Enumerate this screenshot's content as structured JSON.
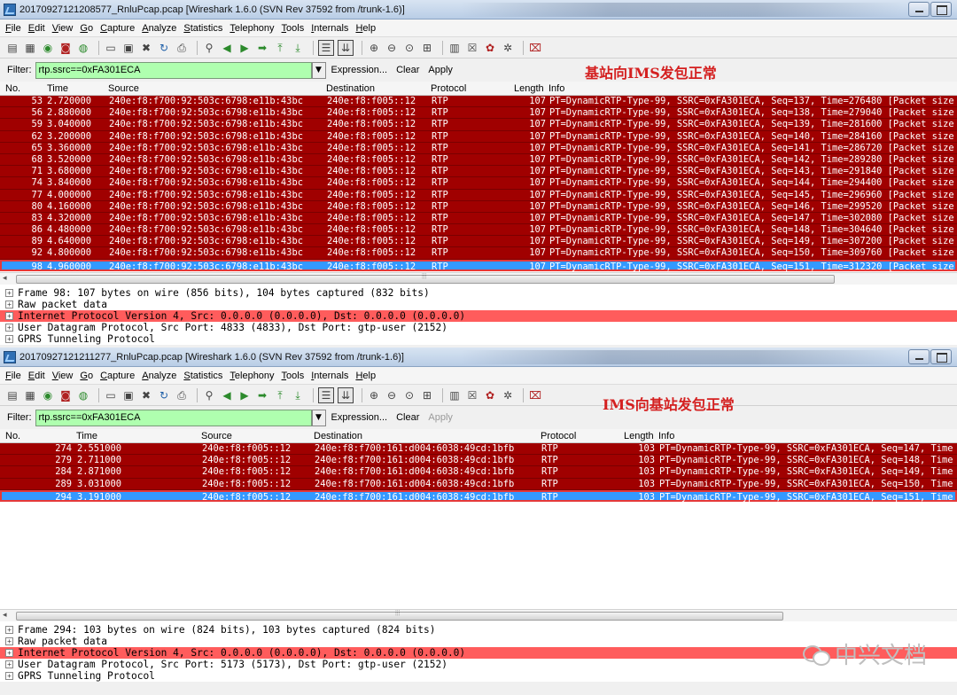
{
  "windows": [
    {
      "title": "20170927121208577_RnluPcap.pcap  [Wireshark 1.6.0  (SVN Rev 37592 from /trunk-1.6)]",
      "menu": [
        "File",
        "Edit",
        "View",
        "Go",
        "Capture",
        "Analyze",
        "Statistics",
        "Telephony",
        "Tools",
        "Internals",
        "Help"
      ],
      "filter": {
        "label": "Filter:",
        "value": "rtp.ssrc==0xFA301ECA",
        "expression": "Expression...",
        "clear": "Clear",
        "apply": "Apply"
      },
      "annotation": "基站向IMS发包正常",
      "columns": [
        "No.",
        "Time",
        "Source",
        "Destination",
        "Protocol",
        "Length",
        "Info"
      ],
      "rows": [
        {
          "no": "53",
          "time": "2.720000",
          "src": "240e:f8:f700:92:503c:6798:e11b:43bc",
          "dst": "240e:f8:f005::12",
          "proto": "RTP",
          "len": "107",
          "info": "PT=DynamicRTP-Type-99, SSRC=0xFA301ECA, Seq=137, Time=276480 [Packet size"
        },
        {
          "no": "56",
          "time": "2.880000",
          "src": "240e:f8:f700:92:503c:6798:e11b:43bc",
          "dst": "240e:f8:f005::12",
          "proto": "RTP",
          "len": "107",
          "info": "PT=DynamicRTP-Type-99, SSRC=0xFA301ECA, Seq=138, Time=279040 [Packet size"
        },
        {
          "no": "59",
          "time": "3.040000",
          "src": "240e:f8:f700:92:503c:6798:e11b:43bc",
          "dst": "240e:f8:f005::12",
          "proto": "RTP",
          "len": "107",
          "info": "PT=DynamicRTP-Type-99, SSRC=0xFA301ECA, Seq=139, Time=281600 [Packet size"
        },
        {
          "no": "62",
          "time": "3.200000",
          "src": "240e:f8:f700:92:503c:6798:e11b:43bc",
          "dst": "240e:f8:f005::12",
          "proto": "RTP",
          "len": "107",
          "info": "PT=DynamicRTP-Type-99, SSRC=0xFA301ECA, Seq=140, Time=284160 [Packet size"
        },
        {
          "no": "65",
          "time": "3.360000",
          "src": "240e:f8:f700:92:503c:6798:e11b:43bc",
          "dst": "240e:f8:f005::12",
          "proto": "RTP",
          "len": "107",
          "info": "PT=DynamicRTP-Type-99, SSRC=0xFA301ECA, Seq=141, Time=286720 [Packet size"
        },
        {
          "no": "68",
          "time": "3.520000",
          "src": "240e:f8:f700:92:503c:6798:e11b:43bc",
          "dst": "240e:f8:f005::12",
          "proto": "RTP",
          "len": "107",
          "info": "PT=DynamicRTP-Type-99, SSRC=0xFA301ECA, Seq=142, Time=289280 [Packet size"
        },
        {
          "no": "71",
          "time": "3.680000",
          "src": "240e:f8:f700:92:503c:6798:e11b:43bc",
          "dst": "240e:f8:f005::12",
          "proto": "RTP",
          "len": "107",
          "info": "PT=DynamicRTP-Type-99, SSRC=0xFA301ECA, Seq=143, Time=291840 [Packet size"
        },
        {
          "no": "74",
          "time": "3.840000",
          "src": "240e:f8:f700:92:503c:6798:e11b:43bc",
          "dst": "240e:f8:f005::12",
          "proto": "RTP",
          "len": "107",
          "info": "PT=DynamicRTP-Type-99, SSRC=0xFA301ECA, Seq=144, Time=294400 [Packet size"
        },
        {
          "no": "77",
          "time": "4.000000",
          "src": "240e:f8:f700:92:503c:6798:e11b:43bc",
          "dst": "240e:f8:f005::12",
          "proto": "RTP",
          "len": "107",
          "info": "PT=DynamicRTP-Type-99, SSRC=0xFA301ECA, Seq=145, Time=296960 [Packet size"
        },
        {
          "no": "80",
          "time": "4.160000",
          "src": "240e:f8:f700:92:503c:6798:e11b:43bc",
          "dst": "240e:f8:f005::12",
          "proto": "RTP",
          "len": "107",
          "info": "PT=DynamicRTP-Type-99, SSRC=0xFA301ECA, Seq=146, Time=299520 [Packet size"
        },
        {
          "no": "83",
          "time": "4.320000",
          "src": "240e:f8:f700:92:503c:6798:e11b:43bc",
          "dst": "240e:f8:f005::12",
          "proto": "RTP",
          "len": "107",
          "info": "PT=DynamicRTP-Type-99, SSRC=0xFA301ECA, Seq=147, Time=302080 [Packet size"
        },
        {
          "no": "86",
          "time": "4.480000",
          "src": "240e:f8:f700:92:503c:6798:e11b:43bc",
          "dst": "240e:f8:f005::12",
          "proto": "RTP",
          "len": "107",
          "info": "PT=DynamicRTP-Type-99, SSRC=0xFA301ECA, Seq=148, Time=304640 [Packet size"
        },
        {
          "no": "89",
          "time": "4.640000",
          "src": "240e:f8:f700:92:503c:6798:e11b:43bc",
          "dst": "240e:f8:f005::12",
          "proto": "RTP",
          "len": "107",
          "info": "PT=DynamicRTP-Type-99, SSRC=0xFA301ECA, Seq=149, Time=307200 [Packet size"
        },
        {
          "no": "92",
          "time": "4.800000",
          "src": "240e:f8:f700:92:503c:6798:e11b:43bc",
          "dst": "240e:f8:f005::12",
          "proto": "RTP",
          "len": "107",
          "info": "PT=DynamicRTP-Type-99, SSRC=0xFA301ECA, Seq=150, Time=309760 [Packet size"
        },
        {
          "no": "98",
          "time": "4.960000",
          "src": "240e:f8:f700:92:503c:6798:e11b:43bc",
          "dst": "240e:f8:f005::12",
          "proto": "RTP",
          "len": "107",
          "info": "PT=DynamicRTP-Type-99, SSRC=0xFA301ECA, Seq=151, Time=312320 [Packet size",
          "selected": true
        }
      ],
      "details": [
        {
          "text": "Frame 98: 107 bytes on wire (856 bits), 104 bytes captured (832 bits)"
        },
        {
          "text": "Raw packet data"
        },
        {
          "text": "Internet Protocol Version 4, Src: 0.0.0.0 (0.0.0.0), Dst: 0.0.0.0 (0.0.0.0)",
          "error": true
        },
        {
          "text": "User Datagram Protocol, Src Port: 4833 (4833), Dst Port: gtp-user (2152)"
        },
        {
          "text": "GPRS Tunneling Protocol"
        }
      ]
    },
    {
      "title": "20170927121211277_RnluPcap.pcap  [Wireshark 1.6.0  (SVN Rev 37592 from /trunk-1.6)]",
      "menu": [
        "File",
        "Edit",
        "View",
        "Go",
        "Capture",
        "Analyze",
        "Statistics",
        "Telephony",
        "Tools",
        "Internals",
        "Help"
      ],
      "filter": {
        "label": "Filter:",
        "value": "rtp.ssrc==0xFA301ECA",
        "expression": "Expression...",
        "clear": "Clear",
        "apply": "Apply"
      },
      "annotation": "IMS向基站发包正常",
      "columns": [
        "No.",
        "Time",
        "Source",
        "Destination",
        "Protocol",
        "Length",
        "Info"
      ],
      "rows": [
        {
          "no": "274",
          "time": "2.551000",
          "src": "240e:f8:f005::12",
          "dst": "240e:f8:f700:161:d004:6038:49cd:1bfb",
          "proto": "RTP",
          "len": "103",
          "info": "PT=DynamicRTP-Type-99, SSRC=0xFA301ECA, Seq=147, Time"
        },
        {
          "no": "279",
          "time": "2.711000",
          "src": "240e:f8:f005::12",
          "dst": "240e:f8:f700:161:d004:6038:49cd:1bfb",
          "proto": "RTP",
          "len": "103",
          "info": "PT=DynamicRTP-Type-99, SSRC=0xFA301ECA, Seq=148, Time"
        },
        {
          "no": "284",
          "time": "2.871000",
          "src": "240e:f8:f005::12",
          "dst": "240e:f8:f700:161:d004:6038:49cd:1bfb",
          "proto": "RTP",
          "len": "103",
          "info": "PT=DynamicRTP-Type-99, SSRC=0xFA301ECA, Seq=149, Time"
        },
        {
          "no": "289",
          "time": "3.031000",
          "src": "240e:f8:f005::12",
          "dst": "240e:f8:f700:161:d004:6038:49cd:1bfb",
          "proto": "RTP",
          "len": "103",
          "info": "PT=DynamicRTP-Type-99, SSRC=0xFA301ECA, Seq=150, Time"
        },
        {
          "no": "294",
          "time": "3.191000",
          "src": "240e:f8:f005::12",
          "dst": "240e:f8:f700:161:d004:6038:49cd:1bfb",
          "proto": "RTP",
          "len": "103",
          "info": "PT=DynamicRTP-Type-99, SSRC=0xFA301ECA, Seq=151, Time",
          "selected": true
        }
      ],
      "details": [
        {
          "text": "Frame 294: 103 bytes on wire (824 bits), 103 bytes captured (824 bits)"
        },
        {
          "text": "Raw packet data"
        },
        {
          "text": "Internet Protocol Version 4, Src: 0.0.0.0 (0.0.0.0), Dst: 0.0.0.0 (0.0.0.0)",
          "error": true
        },
        {
          "text": "User Datagram Protocol, Src Port: 5173 (5173), Dst Port: gtp-user (2152)"
        },
        {
          "text": "GPRS Tunneling Protocol"
        }
      ]
    }
  ],
  "watermark": "中兴文档",
  "icons": {
    "toolbar": [
      "interface-list-icon",
      "capture-options-icon",
      "start-capture-icon",
      "stop-capture-icon",
      "restart-capture-icon",
      "open-file-icon",
      "save-file-icon",
      "close-file-icon",
      "reload-icon",
      "print-icon",
      "find-icon",
      "back-icon",
      "forward-icon",
      "goto-icon",
      "first-packet-icon",
      "last-packet-icon",
      "colorize-icon",
      "autoscroll-icon",
      "zoom-in-icon",
      "zoom-out-icon",
      "normal-size-icon",
      "resize-columns-icon",
      "capture-filters-icon",
      "display-filters-icon",
      "coloring-rules-icon",
      "preferences-icon",
      "help-icon"
    ]
  },
  "colors": {
    "row_bg": "#a00000",
    "selected_bg": "#3399ff",
    "filter_valid": "#afffaf",
    "annotation": "#d42020",
    "error_line": "#ff5c5c"
  }
}
